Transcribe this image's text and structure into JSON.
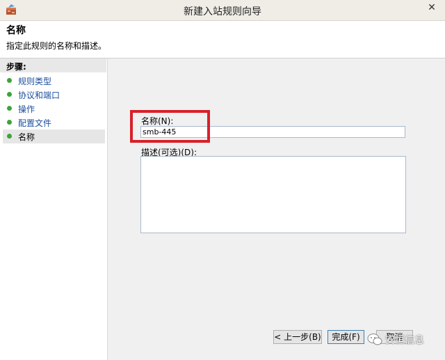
{
  "window": {
    "title": "新建入站规则向导",
    "close_glyph": "✕"
  },
  "header": {
    "title": "名称",
    "description": "指定此规则的名称和描述。"
  },
  "steps": {
    "heading": "步骤:",
    "items": [
      {
        "label": "规则类型",
        "active": false
      },
      {
        "label": "协议和端口",
        "active": false
      },
      {
        "label": "操作",
        "active": false
      },
      {
        "label": "配置文件",
        "active": false
      },
      {
        "label": "名称",
        "active": true
      }
    ]
  },
  "form": {
    "name_label": "名称(N):",
    "name_value": "smb-445",
    "description_label": "描述(可选)(D):",
    "description_value": ""
  },
  "buttons": {
    "back": "< 上一步(B)",
    "finish": "完成(F)",
    "cancel": "取消"
  },
  "watermark": {
    "text": "安恒信息"
  },
  "colors": {
    "highlight": "#d9202a",
    "step_dot": "#3da33a",
    "step_link": "#1a4e9e"
  }
}
